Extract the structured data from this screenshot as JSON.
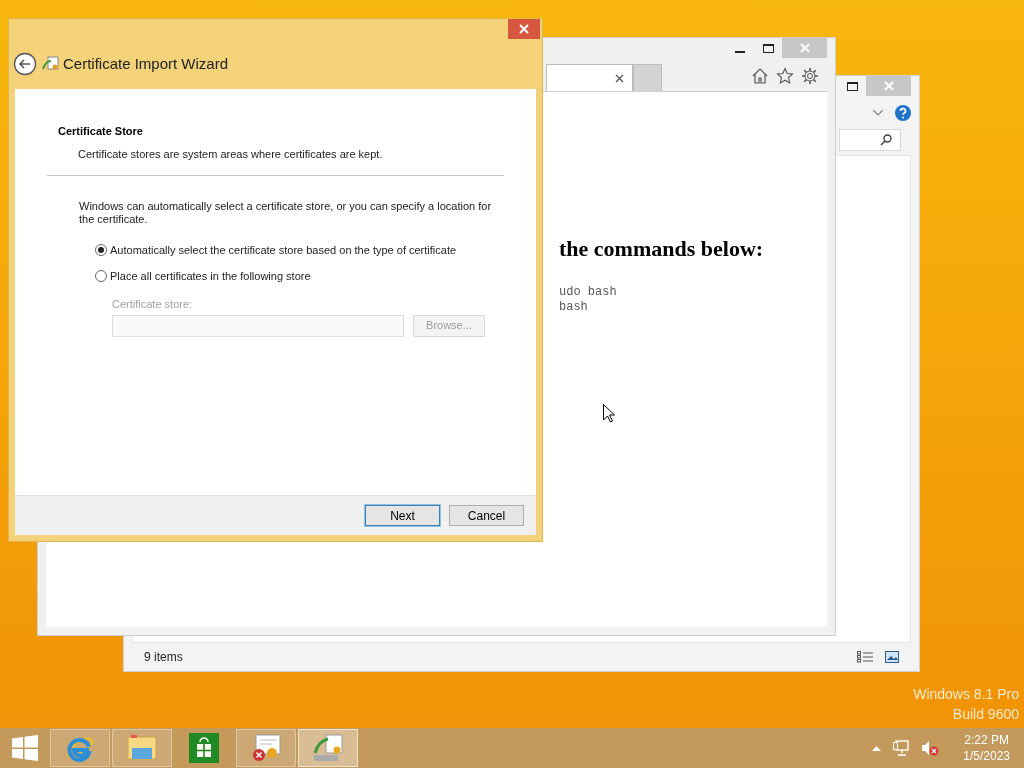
{
  "wizard": {
    "title": "Certificate Import Wizard",
    "section_title": "Certificate Store",
    "section_description": "Certificate stores are system areas where certificates are kept.",
    "intro": "Windows can automatically select a certificate store, or you can specify a location for the certificate.",
    "options": [
      {
        "label": "Automatically select the certificate store based on the type of certificate",
        "selected": true
      },
      {
        "label": "Place all certificates in the following store",
        "selected": false
      }
    ],
    "store_field": {
      "label": "Certificate store:",
      "disabled": true
    },
    "browse_button": {
      "label": "Browse...",
      "disabled": true
    },
    "buttons": [
      {
        "label": "Next",
        "default": true
      },
      {
        "label": "Cancel",
        "default": false
      }
    ]
  },
  "browser": {
    "heading": "the commands below:",
    "code_lines": [
      "udo bash",
      "bash"
    ]
  },
  "explorer": {
    "status": "9 items"
  },
  "desktop": {
    "edition": "Windows 8.1 Pro",
    "build": "Build 9600"
  },
  "taskbar": {
    "apps": [
      {
        "kind": "ie",
        "running": true,
        "selected": false
      },
      {
        "kind": "explorer",
        "running": true,
        "selected": false
      },
      {
        "kind": "store",
        "running": false,
        "selected": false
      },
      {
        "kind": "certificate",
        "running": true,
        "selected": false
      },
      {
        "kind": "wizard",
        "running": true,
        "selected": true
      }
    ],
    "time": "2:22 PM",
    "date": "1/5/2023"
  }
}
